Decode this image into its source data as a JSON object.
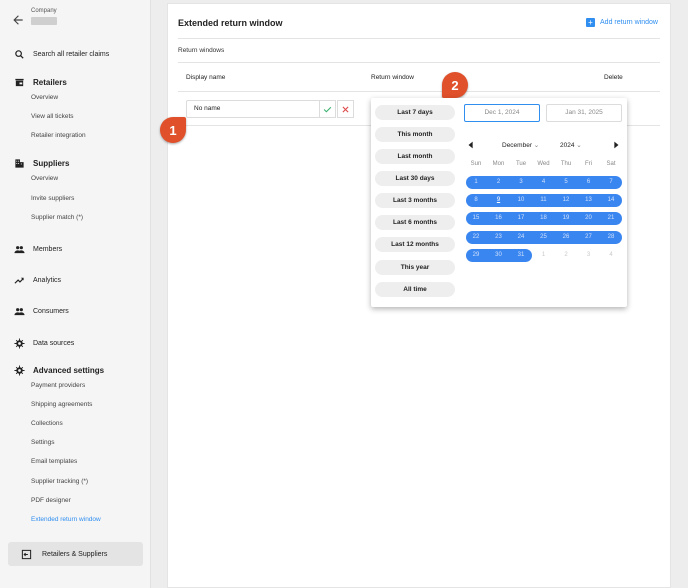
{
  "sidebar": {
    "company_label": "Company",
    "search": "Search all retailer claims",
    "retailers": {
      "title": "Retailers",
      "items": [
        "Overview",
        "View all tickets",
        "Retailer integration"
      ]
    },
    "suppliers": {
      "title": "Suppliers",
      "items": [
        "Overview",
        "Invite suppliers",
        "Supplier match (*)"
      ]
    },
    "members": "Members",
    "analytics": "Analytics",
    "consumers": "Consumers",
    "data_sources": "Data sources",
    "advanced": {
      "title": "Advanced settings",
      "items": [
        "Payment providers",
        "Shipping agreements",
        "Collections",
        "Settings",
        "Email templates",
        "Supplier tracking (*)",
        "PDF designer",
        "Extended return window"
      ]
    },
    "switch_button": "Retailers & Suppliers",
    "accent": "#2f8ef0"
  },
  "main": {
    "title": "Extended return window",
    "add_button": "Add return window",
    "section_label": "Return windows",
    "columns": [
      "Display name",
      "Return window",
      "Delete"
    ],
    "row": {
      "name_value": "No name"
    }
  },
  "badges": [
    "1",
    "2"
  ],
  "picker": {
    "presets": [
      "Last 7 days",
      "This month",
      "Last month",
      "Last 30 days",
      "Last 3 months",
      "Last 6 months",
      "Last 12 months",
      "This year",
      "All time"
    ],
    "start_date": "Dec 1, 2024",
    "end_date": "Jan 31, 2025",
    "month": "December",
    "year": "2024",
    "weekdays": [
      "Sun",
      "Mon",
      "Tue",
      "Wed",
      "Thu",
      "Fri",
      "Sat"
    ],
    "weeks": [
      [
        "1",
        "2",
        "3",
        "4",
        "5",
        "6",
        "7"
      ],
      [
        "8",
        "9",
        "10",
        "11",
        "12",
        "13",
        "14"
      ],
      [
        "15",
        "16",
        "17",
        "18",
        "19",
        "20",
        "21"
      ],
      [
        "22",
        "23",
        "24",
        "25",
        "26",
        "27",
        "28"
      ],
      [
        "29",
        "30",
        "31",
        "1",
        "2",
        "3",
        "4"
      ]
    ],
    "today": "9",
    "range_color": "#3a86f0"
  }
}
